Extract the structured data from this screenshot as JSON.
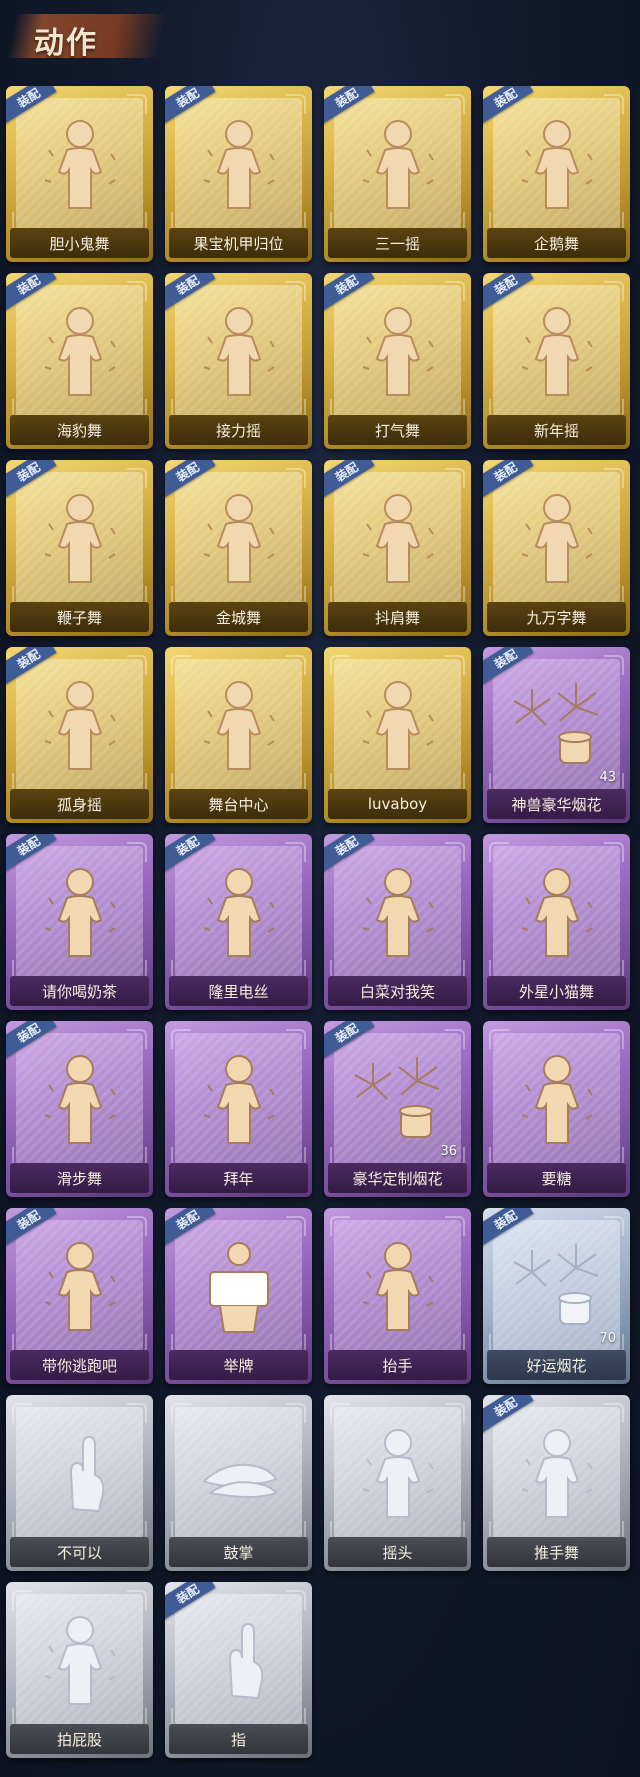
{
  "header": {
    "title": "动作"
  },
  "equip_badge": "装配",
  "items": [
    {
      "label": "胆小鬼舞",
      "tier": "gold",
      "equipped": true,
      "icon": "dance-figure-icon"
    },
    {
      "label": "果宝机甲归位",
      "tier": "gold",
      "equipped": true,
      "icon": "dance-figure-icon"
    },
    {
      "label": "三一摇",
      "tier": "gold",
      "equipped": true,
      "icon": "dance-figure-icon"
    },
    {
      "label": "企鹅舞",
      "tier": "gold",
      "equipped": true,
      "icon": "dance-figure-icon"
    },
    {
      "label": "海豹舞",
      "tier": "gold",
      "equipped": true,
      "icon": "dance-figure-icon"
    },
    {
      "label": "接力摇",
      "tier": "gold",
      "equipped": true,
      "icon": "dance-figure-icon"
    },
    {
      "label": "打气舞",
      "tier": "gold",
      "equipped": true,
      "icon": "dance-figure-icon"
    },
    {
      "label": "新年摇",
      "tier": "gold",
      "equipped": true,
      "icon": "dance-figure-icon"
    },
    {
      "label": "鞭子舞",
      "tier": "gold",
      "equipped": true,
      "icon": "dance-figure-icon"
    },
    {
      "label": "金城舞",
      "tier": "gold",
      "equipped": true,
      "icon": "dance-figure-icon"
    },
    {
      "label": "抖肩舞",
      "tier": "gold",
      "equipped": true,
      "icon": "dance-figure-icon"
    },
    {
      "label": "九万字舞",
      "tier": "gold",
      "equipped": true,
      "icon": "dance-figure-icon"
    },
    {
      "label": "孤身摇",
      "tier": "gold",
      "equipped": true,
      "icon": "dance-figure-icon"
    },
    {
      "label": "舞台中心",
      "tier": "gold",
      "equipped": false,
      "icon": "dance-figure-icon"
    },
    {
      "label": "luvaboy",
      "tier": "gold",
      "equipped": false,
      "icon": "dance-figure-icon"
    },
    {
      "label": "神兽豪华烟花",
      "tier": "purple",
      "equipped": true,
      "icon": "firework-icon",
      "count": "43"
    },
    {
      "label": "请你喝奶茶",
      "tier": "purple",
      "equipped": true,
      "icon": "dance-figure-icon"
    },
    {
      "label": "隆里电丝",
      "tier": "purple",
      "equipped": true,
      "icon": "dance-figure-icon"
    },
    {
      "label": "白菜对我笑",
      "tier": "purple",
      "equipped": true,
      "icon": "dance-figure-icon"
    },
    {
      "label": "外星小猫舞",
      "tier": "purple",
      "equipped": false,
      "icon": "dance-figure-icon"
    },
    {
      "label": "滑步舞",
      "tier": "purple",
      "equipped": true,
      "icon": "dance-figure-icon"
    },
    {
      "label": "拜年",
      "tier": "purple",
      "equipped": false,
      "icon": "bow-figure-icon"
    },
    {
      "label": "豪华定制烟花",
      "tier": "purple",
      "equipped": true,
      "icon": "firework-icon",
      "count": "36"
    },
    {
      "label": "要糖",
      "tier": "purple",
      "equipped": false,
      "icon": "figure-icon"
    },
    {
      "label": "带你逃跑吧",
      "tier": "purple",
      "equipped": true,
      "icon": "dance-figure-icon"
    },
    {
      "label": "举牌",
      "tier": "purple",
      "equipped": true,
      "icon": "sign-figure-icon"
    },
    {
      "label": "抬手",
      "tier": "purple",
      "equipped": false,
      "icon": "figure-icon"
    },
    {
      "label": "好运烟花",
      "tier": "blue",
      "equipped": true,
      "icon": "firework-icon",
      "count": "70"
    },
    {
      "label": "不可以",
      "tier": "silver",
      "equipped": false,
      "icon": "finger-icon"
    },
    {
      "label": "鼓掌",
      "tier": "silver",
      "equipped": false,
      "icon": "clap-hands-icon"
    },
    {
      "label": "摇头",
      "tier": "silver",
      "equipped": false,
      "icon": "figure-icon"
    },
    {
      "label": "推手舞",
      "tier": "silver",
      "equipped": true,
      "icon": "figure-icon"
    },
    {
      "label": "拍屁股",
      "tier": "silver",
      "equipped": false,
      "icon": "figure-icon"
    },
    {
      "label": "指",
      "tier": "silver",
      "equipped": true,
      "icon": "pointing-hand-icon"
    }
  ]
}
